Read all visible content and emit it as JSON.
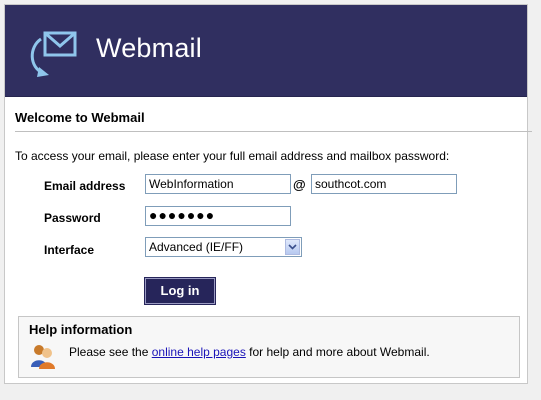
{
  "header": {
    "logo_text": "Webmail",
    "logo_icon": "envelope-icon"
  },
  "welcome": {
    "title": "Welcome to Webmail"
  },
  "intro_text": "To access your email, please enter your full email address and mailbox password:",
  "form": {
    "email_label": "Email address",
    "email_user": "WebInformation",
    "at_symbol": "@",
    "email_domain": "southcot.com",
    "password_label": "Password",
    "password_mask": "●●●●●●●",
    "interface_label": "Interface",
    "interface_value": "Advanced (IE/FF)",
    "login_label": "Log in"
  },
  "help": {
    "title": "Help information",
    "text_before": "Please see the ",
    "link_text": "online help pages",
    "text_after": " for help and more about Webmail.",
    "icon": "users-icon"
  },
  "colors": {
    "banner": "#302f60",
    "button": "#26255a",
    "link": "#1a13b8"
  }
}
